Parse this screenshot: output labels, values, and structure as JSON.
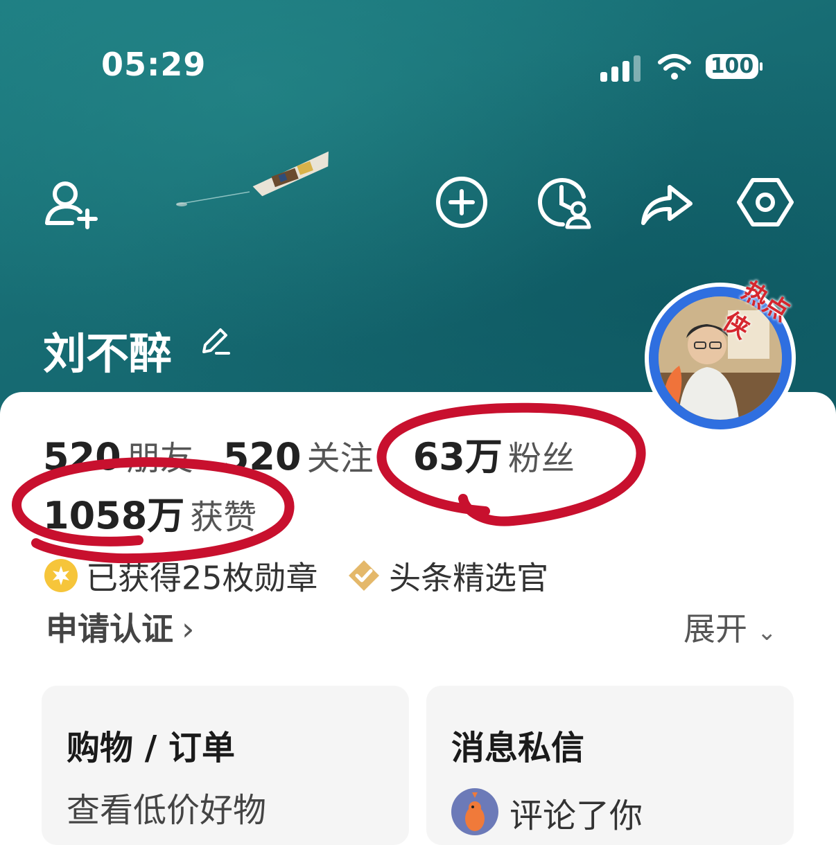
{
  "status_bar": {
    "time": "05:29",
    "battery": "100",
    "icons": [
      "signal-icon",
      "wifi-icon",
      "battery-icon"
    ]
  },
  "header": {
    "actions": [
      "add-friend-icon",
      "add-icon",
      "history-icon",
      "share-icon",
      "settings-icon"
    ]
  },
  "profile": {
    "name": "刘不醉",
    "avatar_badge": "热点侠",
    "stats": [
      {
        "number": "520",
        "label": "朋友"
      },
      {
        "number": "520",
        "label": "关注"
      },
      {
        "number": "63万",
        "label": "粉丝"
      }
    ],
    "likes": {
      "number": "1058万",
      "label": "获赞"
    },
    "badges": [
      {
        "icon": "medal-icon",
        "text": "已获得25枚勋章"
      },
      {
        "icon": "selector-badge-icon",
        "text": "头条精选官"
      }
    ],
    "verify_link": "申请认证",
    "expand_link": "展开"
  },
  "tiles": [
    {
      "title": "购物 / 订单",
      "subtitle": "查看低价好物"
    },
    {
      "title": "消息私信",
      "subtitle": "评论了你"
    }
  ],
  "colors": {
    "hero_sea": "#176c73",
    "annotation_red": "#c8102e",
    "avatar_ring": "#2f6fe0",
    "badge_gold": "#f6c53a"
  }
}
